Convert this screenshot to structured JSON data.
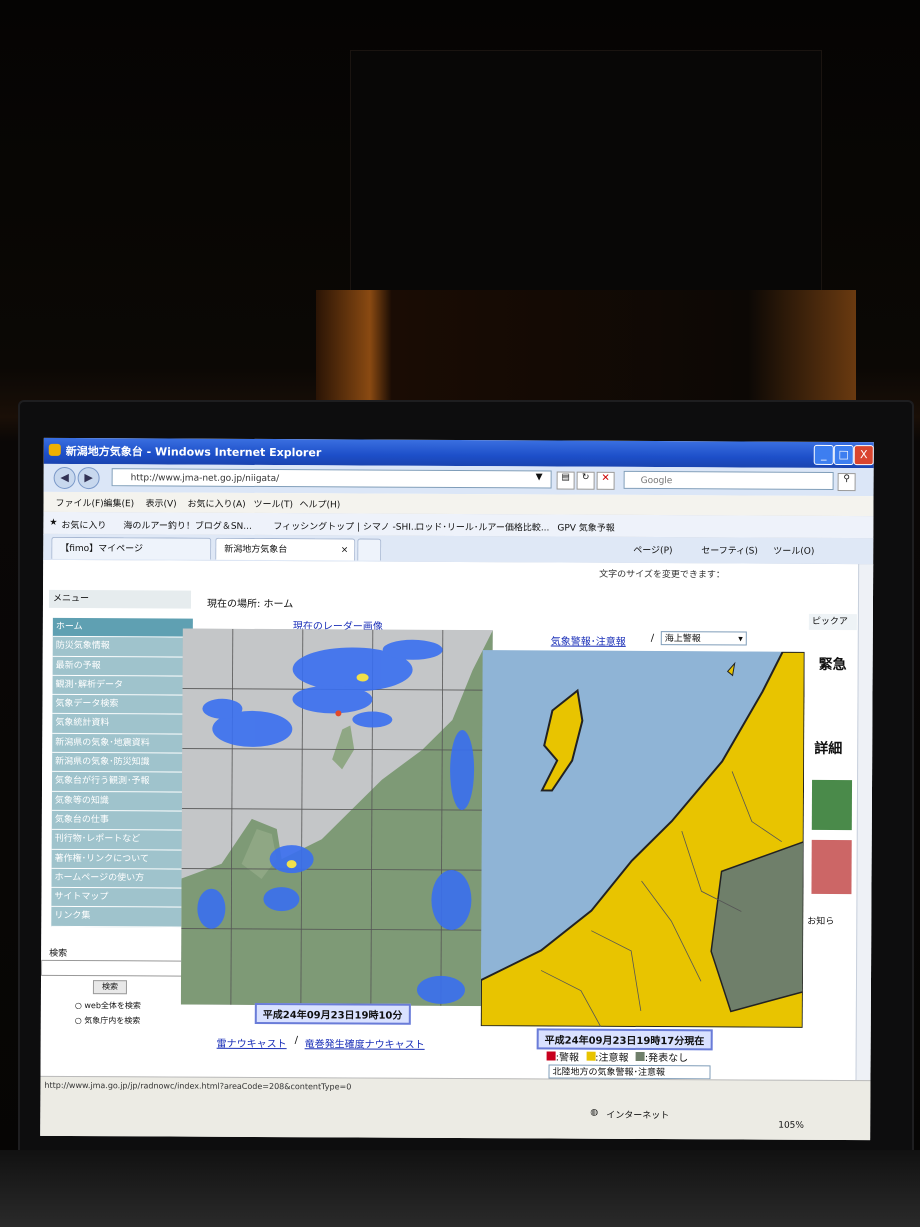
{
  "window": {
    "title": "新潟地方気象台 - Windows Internet Explorer",
    "buttons": {
      "minimize": "_",
      "maximize": "□",
      "close": "X"
    }
  },
  "address_bar": {
    "url": "http://www.jma-net.go.jp/niigata/",
    "search_placeholder": "Google"
  },
  "menu": [
    "ファイル(F)",
    "編集(E)",
    "表示(V)",
    "お気に入り(A)",
    "ツール(T)",
    "ヘルプ(H)"
  ],
  "favorites": {
    "label": "お気に入り",
    "items": [
      "海のルアー釣り！ブログ＆SN...",
      "フィッシングトップ | シマノ -SHI...",
      "ロッド･リール･ルアー価格比較...",
      "GPV 気象予報"
    ]
  },
  "tabs": [
    {
      "label": "【fimo】マイページ"
    },
    {
      "label": "新潟地方気象台"
    }
  ],
  "command_bar": [
    "ページ(P)",
    "セーフティ(S)",
    "ツール(O)"
  ],
  "page": {
    "font_size_note": "文字のサイズを変更できます：",
    "breadcrumb": "現在の場所: ホーム",
    "pickup_label": "ピックア",
    "right_labels": [
      "緊急",
      "詳細",
      "お知ら"
    ],
    "sidebar": {
      "heading": "メニュー",
      "items": [
        "ホーム",
        "防災気象情報",
        "最新の予報",
        "観測･解析データ",
        "気象データ検索",
        "気象統計資料",
        "新潟県の気象･地震資料",
        "新潟県の気象･防災知識",
        "気象台が行う観測･予報",
        "気象等の知識",
        "気象台の仕事",
        "刊行物･レポートなど",
        "著作権･リンクについて",
        "ホームページの使い方",
        "サイトマップ",
        "リンク集"
      ],
      "search_heading": "検索",
      "search_button": "検索",
      "search_options": [
        "web全体を検索",
        "気象庁内を検索"
      ]
    },
    "radar": {
      "title": "現在のレーダー画像",
      "timestamp": "平成24年09月23日19時10分",
      "links": [
        "雷ナウキャスト",
        "竜巻発生確度ナウキャスト"
      ]
    },
    "warnings": {
      "title": "気象警報･注意報",
      "separator": "/",
      "select_value": "海上警報",
      "timestamp": "平成24年09月23日19時17分現在",
      "legend": [
        {
          "label": ":警報",
          "color": "#c8001e"
        },
        {
          "label": ":注意報",
          "color": "#e8c400"
        },
        {
          "label": ":発表なし",
          "color": "#6f7f6a"
        }
      ],
      "region_select": "北陸地方の気象警報･注意報"
    }
  },
  "status": {
    "url": "http://www.jma.go.jp/jp/radnowc/index.html?areaCode=208&contentType=0",
    "zone": "インターネット",
    "zoom": "105%"
  },
  "colors": {
    "title_bar": "#1d4fc9",
    "sea": "#8fb4d6",
    "advisory": "#e8c400",
    "radar_echo": "#3a6ff0"
  }
}
